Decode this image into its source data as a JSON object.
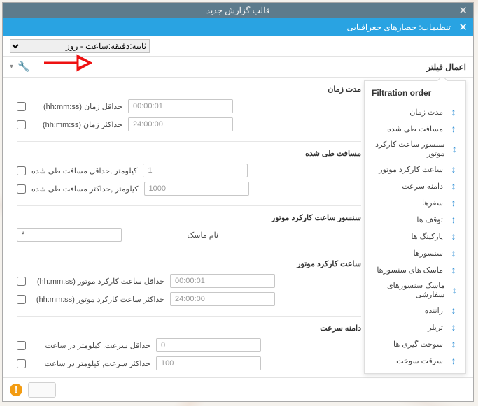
{
  "titlebar": {
    "title": "قالب گزارش جدید"
  },
  "subheader": {
    "title": "تنظیمات: حصارهای جغرافیایی"
  },
  "topselect": {
    "selected": "ثانیه:دقیقه:ساعت - روز"
  },
  "filterbar": {
    "label": "اعمال فیلتر"
  },
  "sections": {
    "duration": {
      "title": "مدت زمان",
      "min_label": "حداقل زمان (hh:mm:ss)",
      "min_value": "00:00:01",
      "max_label": "حداکثر زمان (hh:mm:ss)",
      "max_value": "24:00:00"
    },
    "mileage": {
      "title": "مسافت طی شده",
      "min_label": "کیلومتر ,حداقل مسافت طی شده",
      "min_value": "1",
      "max_label": "کیلومتر ,حداکثر مسافت طی شده",
      "max_value": "1000"
    },
    "engine_sensor": {
      "title": "سنسور ساعت کارکرد موتور",
      "mask_label": "نام ماسک",
      "mask_value": "*"
    },
    "engine_hours": {
      "title": "ساعت کارکرد موتور",
      "min_label": "حداقل ساعت کارکرد موتور (hh:mm:ss)",
      "min_value": "00:00:01",
      "max_label": "حداکثر ساعت کارکرد موتور (hh:mm:ss)",
      "max_value": "24:00:00"
    },
    "speed": {
      "title": "دامنه سرعت",
      "min_label": "حداقل سرعت, کیلومتر در ساعت",
      "min_value": "0",
      "max_label": "حداکثر سرعت, کیلومتر در ساعت",
      "max_value": "100"
    }
  },
  "dropdown": {
    "title": "Filtration order",
    "items": [
      "مدت زمان",
      "مسافت طی شده",
      "سنسور ساعت کارکرد موتور",
      "ساعت کارکرد موتور",
      "دامنه سرعت",
      "سفرها",
      "توقف ها",
      "پارکینگ ها",
      "سنسورها",
      "ماسک های سنسورها",
      "ماسک سنسورهای سفارشی",
      "راننده",
      "تریلر",
      "سوخت گیری ها",
      "سرقت سوخت"
    ]
  },
  "footer": {
    "warn": "!"
  }
}
